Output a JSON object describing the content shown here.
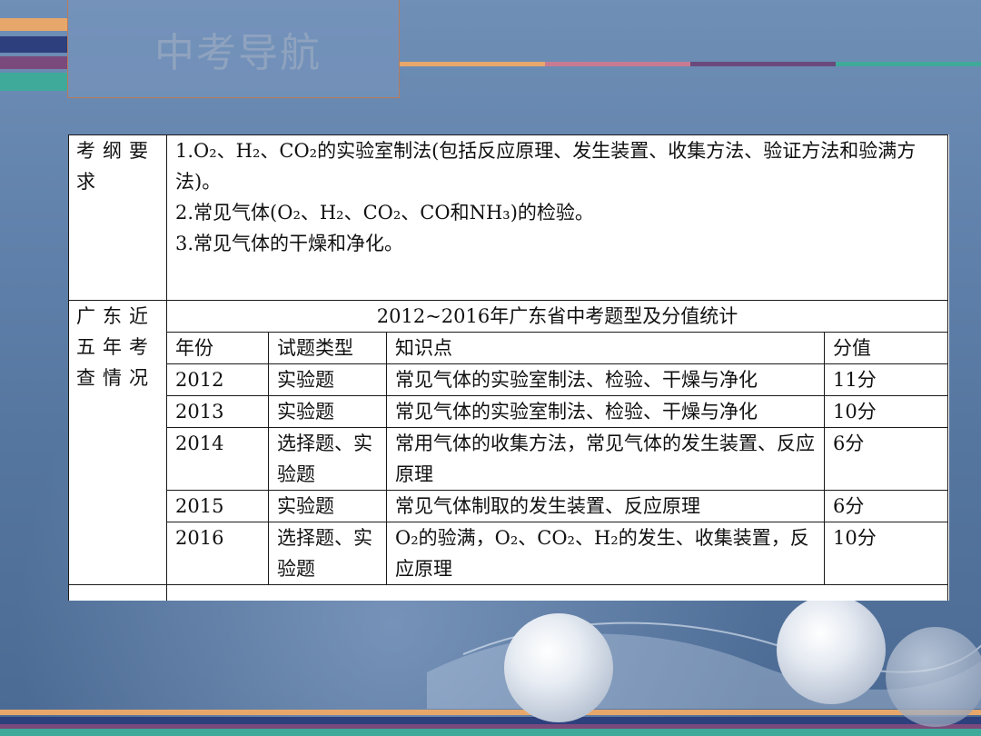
{
  "slide": {
    "title": "中考导航",
    "colors": {
      "accent_orange": "#e8a76a",
      "accent_purple": "#7b4a7c",
      "accent_teal": "#3fa99a",
      "accent_navy": "#2e3f7d",
      "accent_pink": "#c77b93"
    }
  },
  "table": {
    "row1_header": "考纲要求",
    "requirements": [
      "1.O₂、H₂、CO₂的实验室制法(包括反应原理、发生装置、收集方法、验证方法和验满方法)。",
      "2.常见气体(O₂、H₂、CO₂、CO和NH₃)的检验。",
      "3.常见气体的干燥和净化。"
    ],
    "row2_header": "广东近五年考查情况",
    "stats_title": "2012~2016年广东省中考题型及分值统计",
    "columns": [
      "年份",
      "试题类型",
      "知识点",
      "分值"
    ],
    "rows": [
      {
        "year": "2012",
        "type": "实验题",
        "knowledge": "常见气体的实验室制法、检验、干燥与净化",
        "score": "11分"
      },
      {
        "year": "2013",
        "type": "实验题",
        "knowledge": "常见气体的实验室制法、检验、干燥与净化",
        "score": "10分"
      },
      {
        "year": "2014",
        "type": "选择题、实验题",
        "knowledge": "常用气体的收集方法，常见气体的发生装置、反应原理",
        "score": "6分"
      },
      {
        "year": "2015",
        "type": "实验题",
        "knowledge": "常见气体制取的发生装置、反应原理",
        "score": "6分"
      },
      {
        "year": "2016",
        "type": "选择题、实验题",
        "knowledge": "O₂的验满，O₂、CO₂、H₂的发生、收集装置，反应原理",
        "score": "10分"
      }
    ]
  }
}
